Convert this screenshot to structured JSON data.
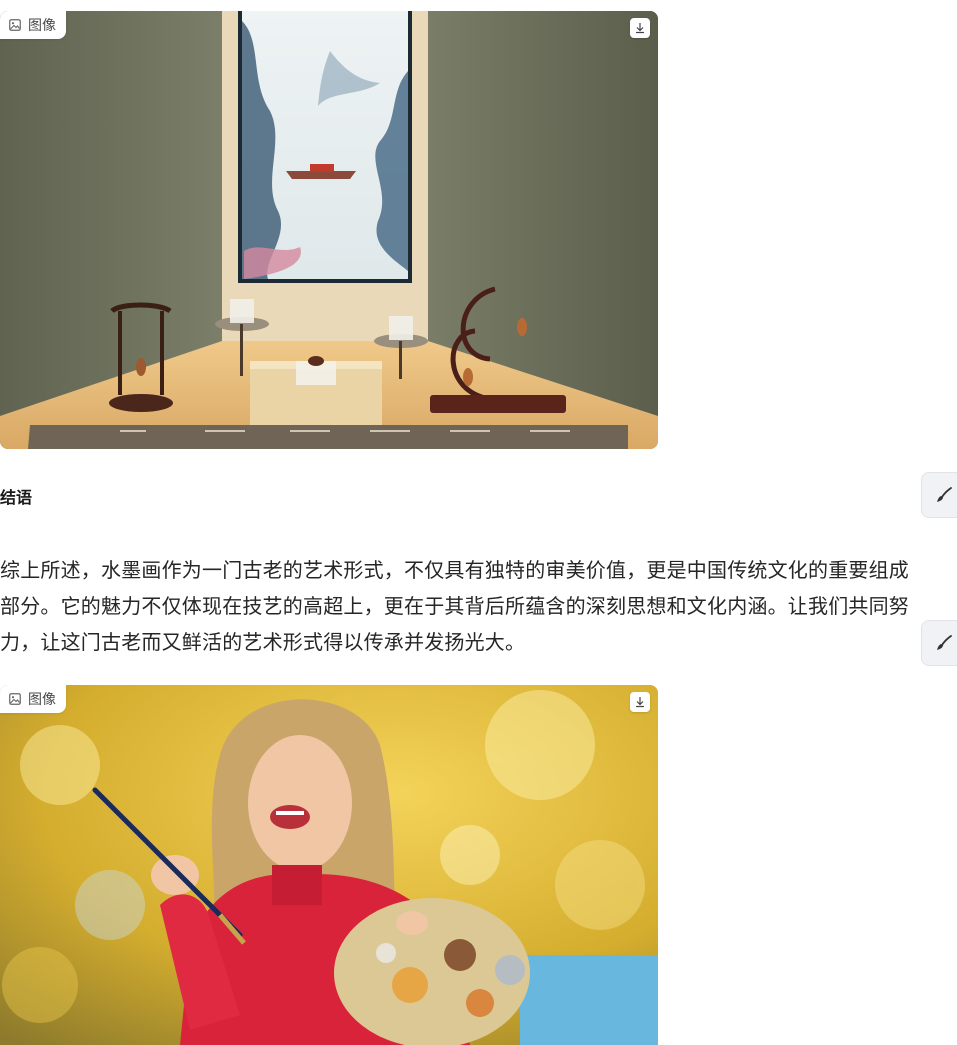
{
  "images": [
    {
      "badge_label": "图像",
      "badge_icon": "image-icon",
      "download_icon": "download-icon",
      "subject": "museum-display"
    },
    {
      "badge_label": "图像",
      "badge_icon": "image-icon",
      "download_icon": "download-icon",
      "subject": "painter-portrait"
    }
  ],
  "section": {
    "heading": "结语",
    "paragraph": "综上所述，水墨画作为一门古老的艺术形式，不仅具有独特的审美价值，更是中国传统文化的重要组成部分。它的魅力不仅体现在技艺的高超上，更在于其背后所蕴含的深刻思想和文化内涵。让我们共同努力，让这门古老而又鲜活的艺术形式得以传承并发扬光大。"
  },
  "side_buttons": [
    {
      "icon": "brush-icon"
    },
    {
      "icon": "brush-icon"
    }
  ],
  "colors": {
    "badge_bg": "#ffffff",
    "side_button_bg": "#f1f2f5",
    "text": "#262626"
  }
}
